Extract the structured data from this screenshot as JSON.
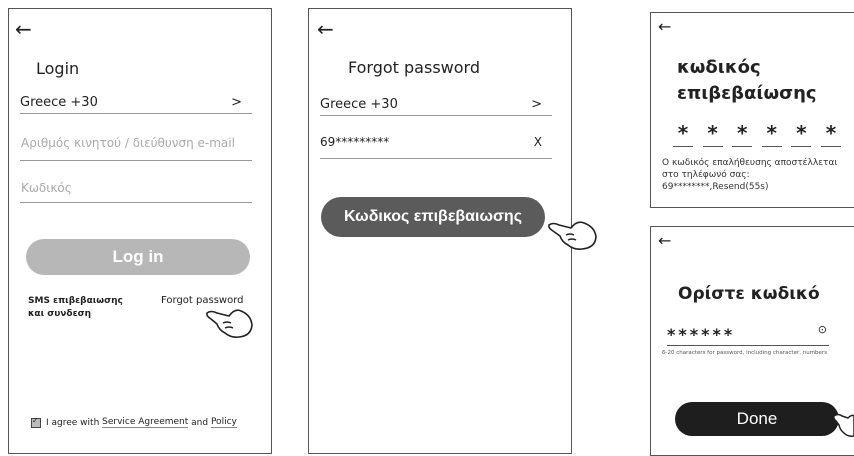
{
  "login": {
    "title": "Login",
    "country": "Greece +30",
    "country_arrow": ">",
    "phone_placeholder": "Αριθμός κινητού / διεύθυνση e-mail",
    "password_placeholder": "Κωδικός",
    "login_button": "Log in",
    "sms_link_line1": "SMS επιβεβαιωσης",
    "sms_link_line2": "και συνδεση",
    "forgot_link": "Forgot password",
    "agree_prefix": "I agree with",
    "service_agreement": "Service Agreement",
    "and_text": "and",
    "policy": "Policy"
  },
  "forgot": {
    "title": "Forgot password",
    "country": "Greece +30",
    "country_arrow": ">",
    "phone_value": "69*********",
    "clear_label": "X",
    "verify_button": "Κωδικος επιβεβαιωσης"
  },
  "code": {
    "title_line1": "κωδικός",
    "title_line2": "επιβεβαίωσης",
    "digits": [
      "*",
      "*",
      "*",
      "*",
      "*",
      "*"
    ],
    "info_line1": "Ο κωδικός επαλήθευσης αποστέλλεται",
    "info_line2": "στο τηλέφωνό σας:",
    "info_line3": "69********,Resend(55s)"
  },
  "setpw": {
    "title": "Ορίστε κωδικό",
    "password_value": "******",
    "hint": "6-20 characters for password, including character, numbers",
    "done_button": "Done"
  },
  "icons": {
    "back": "←",
    "eye": "⊙",
    "check": "✓"
  },
  "colors": {
    "login_button": "#b7b7b7",
    "verify_button": "#5b5b5b",
    "done_button": "#1e1e1e"
  }
}
